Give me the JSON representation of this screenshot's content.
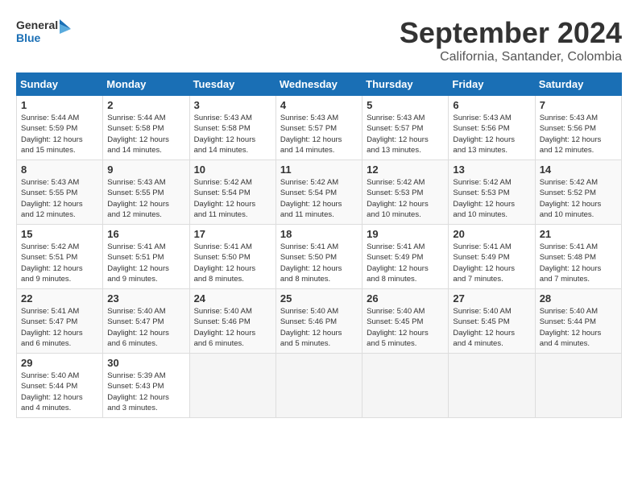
{
  "header": {
    "logo_line1": "General",
    "logo_line2": "Blue",
    "month": "September 2024",
    "location": "California, Santander, Colombia"
  },
  "days_of_week": [
    "Sunday",
    "Monday",
    "Tuesday",
    "Wednesday",
    "Thursday",
    "Friday",
    "Saturday"
  ],
  "weeks": [
    [
      {
        "day": "1",
        "info": "Sunrise: 5:44 AM\nSunset: 5:59 PM\nDaylight: 12 hours\nand 15 minutes."
      },
      {
        "day": "2",
        "info": "Sunrise: 5:44 AM\nSunset: 5:58 PM\nDaylight: 12 hours\nand 14 minutes."
      },
      {
        "day": "3",
        "info": "Sunrise: 5:43 AM\nSunset: 5:58 PM\nDaylight: 12 hours\nand 14 minutes."
      },
      {
        "day": "4",
        "info": "Sunrise: 5:43 AM\nSunset: 5:57 PM\nDaylight: 12 hours\nand 14 minutes."
      },
      {
        "day": "5",
        "info": "Sunrise: 5:43 AM\nSunset: 5:57 PM\nDaylight: 12 hours\nand 13 minutes."
      },
      {
        "day": "6",
        "info": "Sunrise: 5:43 AM\nSunset: 5:56 PM\nDaylight: 12 hours\nand 13 minutes."
      },
      {
        "day": "7",
        "info": "Sunrise: 5:43 AM\nSunset: 5:56 PM\nDaylight: 12 hours\nand 12 minutes."
      }
    ],
    [
      {
        "day": "8",
        "info": "Sunrise: 5:43 AM\nSunset: 5:55 PM\nDaylight: 12 hours\nand 12 minutes."
      },
      {
        "day": "9",
        "info": "Sunrise: 5:43 AM\nSunset: 5:55 PM\nDaylight: 12 hours\nand 12 minutes."
      },
      {
        "day": "10",
        "info": "Sunrise: 5:42 AM\nSunset: 5:54 PM\nDaylight: 12 hours\nand 11 minutes."
      },
      {
        "day": "11",
        "info": "Sunrise: 5:42 AM\nSunset: 5:54 PM\nDaylight: 12 hours\nand 11 minutes."
      },
      {
        "day": "12",
        "info": "Sunrise: 5:42 AM\nSunset: 5:53 PM\nDaylight: 12 hours\nand 10 minutes."
      },
      {
        "day": "13",
        "info": "Sunrise: 5:42 AM\nSunset: 5:53 PM\nDaylight: 12 hours\nand 10 minutes."
      },
      {
        "day": "14",
        "info": "Sunrise: 5:42 AM\nSunset: 5:52 PM\nDaylight: 12 hours\nand 10 minutes."
      }
    ],
    [
      {
        "day": "15",
        "info": "Sunrise: 5:42 AM\nSunset: 5:51 PM\nDaylight: 12 hours\nand 9 minutes."
      },
      {
        "day": "16",
        "info": "Sunrise: 5:41 AM\nSunset: 5:51 PM\nDaylight: 12 hours\nand 9 minutes."
      },
      {
        "day": "17",
        "info": "Sunrise: 5:41 AM\nSunset: 5:50 PM\nDaylight: 12 hours\nand 8 minutes."
      },
      {
        "day": "18",
        "info": "Sunrise: 5:41 AM\nSunset: 5:50 PM\nDaylight: 12 hours\nand 8 minutes."
      },
      {
        "day": "19",
        "info": "Sunrise: 5:41 AM\nSunset: 5:49 PM\nDaylight: 12 hours\nand 8 minutes."
      },
      {
        "day": "20",
        "info": "Sunrise: 5:41 AM\nSunset: 5:49 PM\nDaylight: 12 hours\nand 7 minutes."
      },
      {
        "day": "21",
        "info": "Sunrise: 5:41 AM\nSunset: 5:48 PM\nDaylight: 12 hours\nand 7 minutes."
      }
    ],
    [
      {
        "day": "22",
        "info": "Sunrise: 5:41 AM\nSunset: 5:47 PM\nDaylight: 12 hours\nand 6 minutes."
      },
      {
        "day": "23",
        "info": "Sunrise: 5:40 AM\nSunset: 5:47 PM\nDaylight: 12 hours\nand 6 minutes."
      },
      {
        "day": "24",
        "info": "Sunrise: 5:40 AM\nSunset: 5:46 PM\nDaylight: 12 hours\nand 6 minutes."
      },
      {
        "day": "25",
        "info": "Sunrise: 5:40 AM\nSunset: 5:46 PM\nDaylight: 12 hours\nand 5 minutes."
      },
      {
        "day": "26",
        "info": "Sunrise: 5:40 AM\nSunset: 5:45 PM\nDaylight: 12 hours\nand 5 minutes."
      },
      {
        "day": "27",
        "info": "Sunrise: 5:40 AM\nSunset: 5:45 PM\nDaylight: 12 hours\nand 4 minutes."
      },
      {
        "day": "28",
        "info": "Sunrise: 5:40 AM\nSunset: 5:44 PM\nDaylight: 12 hours\nand 4 minutes."
      }
    ],
    [
      {
        "day": "29",
        "info": "Sunrise: 5:40 AM\nSunset: 5:44 PM\nDaylight: 12 hours\nand 4 minutes."
      },
      {
        "day": "30",
        "info": "Sunrise: 5:39 AM\nSunset: 5:43 PM\nDaylight: 12 hours\nand 3 minutes."
      },
      {
        "day": "",
        "info": ""
      },
      {
        "day": "",
        "info": ""
      },
      {
        "day": "",
        "info": ""
      },
      {
        "day": "",
        "info": ""
      },
      {
        "day": "",
        "info": ""
      }
    ]
  ]
}
